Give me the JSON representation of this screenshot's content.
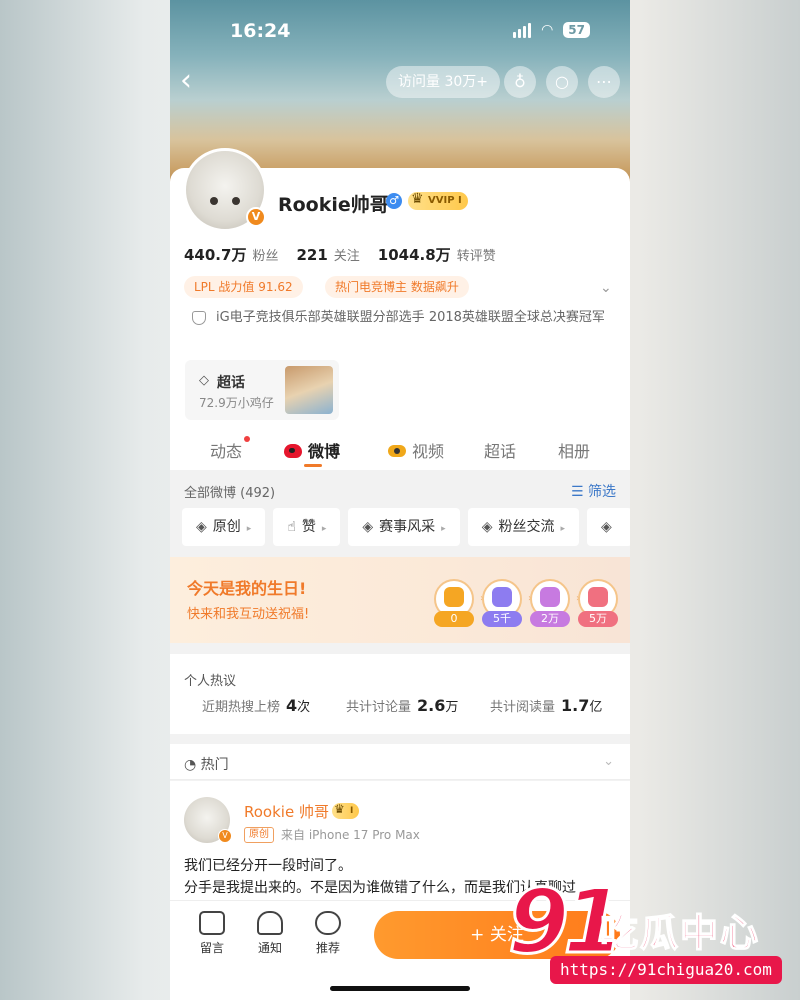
{
  "status": {
    "time": "16:24",
    "battery": "57"
  },
  "topnav": {
    "visits": "访问量 30万+",
    "back_icon": "‹"
  },
  "profile": {
    "name": "Rookie帅哥",
    "gender_icon": "♂",
    "vip_badge": "VVIP I",
    "verified": "V",
    "stats": [
      {
        "value": "440.7万",
        "label": "粉丝"
      },
      {
        "value": "221",
        "label": "关注"
      },
      {
        "value": "1044.8万",
        "label": "转评赞"
      }
    ],
    "tags": [
      "LPL 战力值  91.62",
      "热门电竞博主 数据飙升"
    ],
    "description": "iG电子竞技俱乐部英雄联盟分部选手 2018英雄联盟全球总决赛冠军",
    "chaohua": {
      "title": "超话",
      "subtitle": "72.9万小鸡仔"
    }
  },
  "tabs": [
    "动态",
    "微博",
    "视频",
    "超话",
    "相册"
  ],
  "filter": {
    "all": "全部微博 (492)",
    "filter_label": "筛选"
  },
  "chips": [
    "原创",
    "赞",
    "赛事风采",
    "粉丝交流"
  ],
  "birthday": {
    "title": "今天是我的生日!",
    "subtitle": "快来和我互动送祝福!",
    "gifts": [
      {
        "count": "0",
        "color": "#f5a623"
      },
      {
        "count": "5千",
        "color": "#8d7cf0"
      },
      {
        "count": "2万",
        "color": "#c77ae0"
      },
      {
        "count": "5万",
        "color": "#f07080"
      }
    ]
  },
  "hot_discussion": {
    "title": "个人热议",
    "items": [
      {
        "label": "近期热搜上榜",
        "value": "4",
        "unit": "次"
      },
      {
        "label": "共计讨论量",
        "value": "2.6",
        "unit": "万"
      },
      {
        "label": "共计阅读量",
        "value": "1.7",
        "unit": "亿"
      }
    ]
  },
  "section": {
    "label": "热门"
  },
  "post": {
    "author": "Rookie 帅哥",
    "badge": "I",
    "origin_tag": "原创",
    "source": "来自 iPhone 17 Pro Max",
    "line1": "我们已经分开一段时间了。",
    "line2": "分手是我提出来的。不是因为谁做错了什么，而是我们认真聊过"
  },
  "bottom": {
    "comment": "留言",
    "notify": "通知",
    "recommend": "推荐",
    "follow": "+ 关注"
  },
  "watermark": {
    "num": "91",
    "text": "吃瓜中心",
    "url": "https://91chigua20.com"
  }
}
